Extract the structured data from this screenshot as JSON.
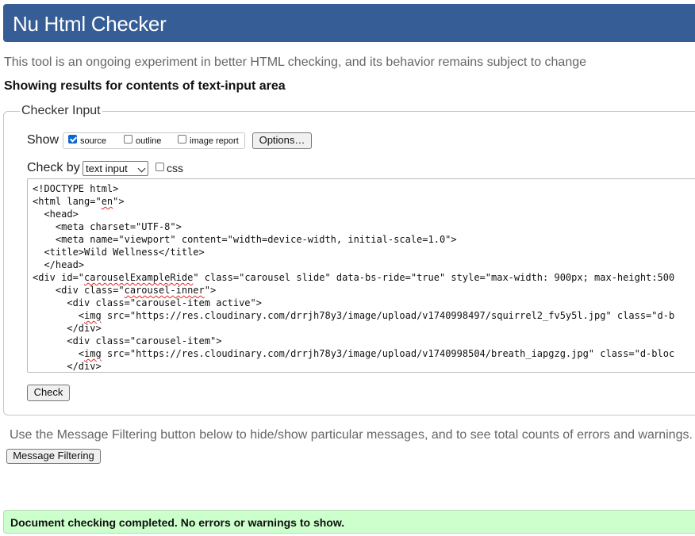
{
  "header": {
    "title": "Nu Html Checker"
  },
  "intro_text": "This tool is an ongoing experiment in better HTML checking, and its behavior remains subject to change",
  "results_heading": "Showing results for contents of text-input area",
  "checker_input": {
    "legend": "Checker Input",
    "show_label": "Show",
    "show_options": [
      {
        "label": "source",
        "checked": true
      },
      {
        "label": "outline",
        "checked": false
      },
      {
        "label": "image report",
        "checked": false
      }
    ],
    "options_button": "Options…",
    "check_by_label": "Check by",
    "check_by_selected": "text input",
    "css_label": "css",
    "css_checked": false,
    "source_lines": [
      "<!DOCTYPE html>",
      "<html lang=\"en\">",
      "  <head>",
      "    <meta charset=\"UTF-8\">",
      "    <meta name=\"viewport\" content=\"width=device-width, initial-scale=1.0\">",
      "  <title>Wild Wellness</title>",
      "  </head>",
      "<div id=\"carouselExampleRide\" class=\"carousel slide\" data-bs-ride=\"true\" style=\"max-width: 900px; max-height:500",
      "    <div class=\"carousel-inner\">",
      "      <div class=\"carousel-item active\">",
      "        <img src=\"https://res.cloudinary.com/drrjh78y3/image/upload/v1740998497/squirrel2_fv5y5l.jpg\" class=\"d-b",
      "      </div>",
      "      <div class=\"carousel-item\">",
      "        <img src=\"https://res.cloudinary.com/drrjh78y3/image/upload/v1740998504/breath_iapgzg.jpg\" class=\"d-bloc",
      "      </div>"
    ],
    "check_button": "Check"
  },
  "filter_note": "Use the Message Filtering button below to hide/show particular messages, and to see total counts of errors and warnings.",
  "filter_button": "Message Filtering",
  "success_message": "Document checking completed. No errors or warnings to show."
}
